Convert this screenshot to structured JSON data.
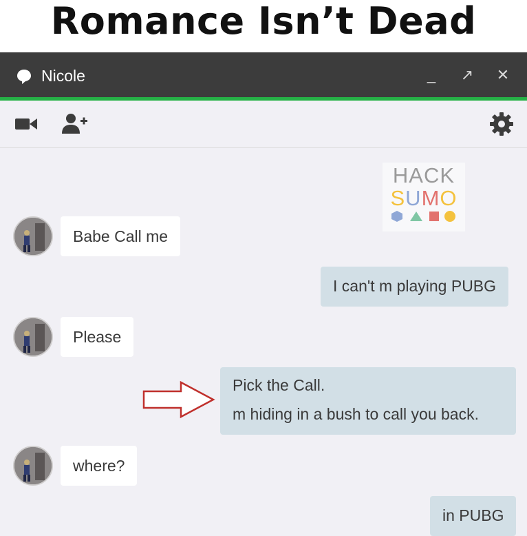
{
  "meme": {
    "title": "Romance Isn’t Dead"
  },
  "window": {
    "contact_name": "Nicole",
    "minimize_label": "_",
    "popout_label": "↗",
    "close_label": "✕",
    "accent_color": "#25b146",
    "titlebar_color": "#3c3c3c"
  },
  "toolbar": {
    "icons": [
      "video-call-icon",
      "add-person-icon",
      "gear-icon"
    ]
  },
  "watermark": {
    "line1": "HACK",
    "line2_parts": [
      "S",
      "U",
      "M",
      "O"
    ],
    "line2_colors": [
      "#f4c23e",
      "#8fa7d6",
      "#e2726e",
      "#f4c23e"
    ]
  },
  "messages": [
    {
      "from": "contact",
      "text": "Babe Call me"
    },
    {
      "from": "me",
      "text": "I can't m playing PUBG"
    },
    {
      "from": "contact",
      "text": "Please"
    },
    {
      "from": "me",
      "lines": [
        "Pick the Call.",
        "m hiding in a bush to call you back."
      ],
      "annotated": true
    },
    {
      "from": "contact",
      "text": "where?"
    },
    {
      "from": "me",
      "text": "in PUBG"
    }
  ],
  "annotation": {
    "type": "arrow",
    "color": "#c0302c"
  }
}
